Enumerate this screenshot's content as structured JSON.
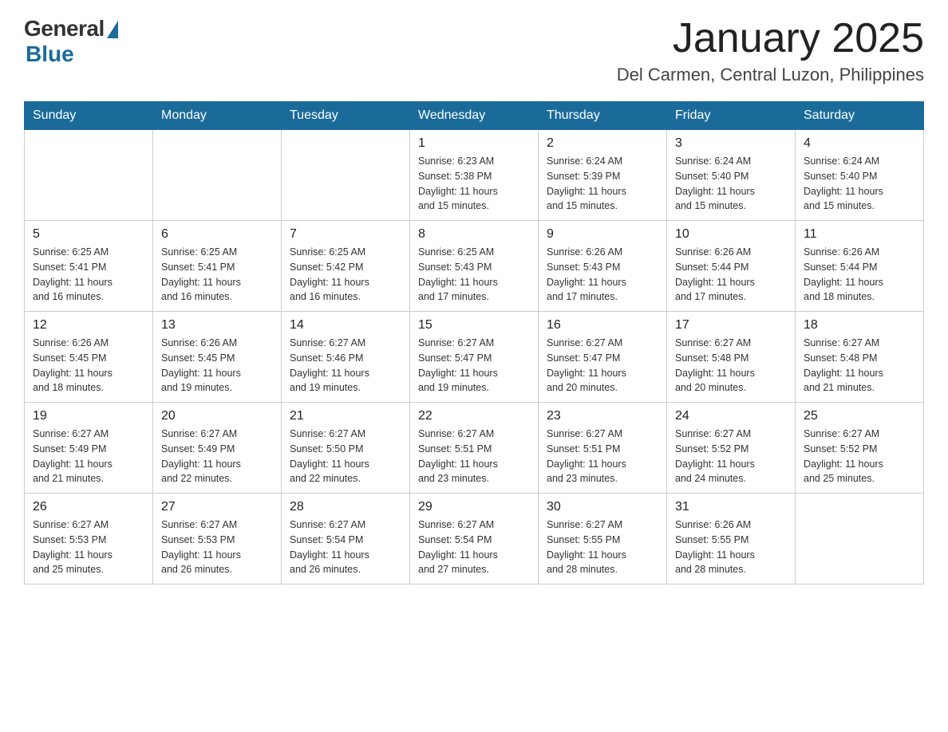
{
  "header": {
    "logo_general": "General",
    "logo_blue": "Blue",
    "month_title": "January 2025",
    "location": "Del Carmen, Central Luzon, Philippines"
  },
  "weekdays": [
    "Sunday",
    "Monday",
    "Tuesday",
    "Wednesday",
    "Thursday",
    "Friday",
    "Saturday"
  ],
  "weeks": [
    [
      {
        "day": "",
        "info": ""
      },
      {
        "day": "",
        "info": ""
      },
      {
        "day": "",
        "info": ""
      },
      {
        "day": "1",
        "info": "Sunrise: 6:23 AM\nSunset: 5:38 PM\nDaylight: 11 hours\nand 15 minutes."
      },
      {
        "day": "2",
        "info": "Sunrise: 6:24 AM\nSunset: 5:39 PM\nDaylight: 11 hours\nand 15 minutes."
      },
      {
        "day": "3",
        "info": "Sunrise: 6:24 AM\nSunset: 5:40 PM\nDaylight: 11 hours\nand 15 minutes."
      },
      {
        "day": "4",
        "info": "Sunrise: 6:24 AM\nSunset: 5:40 PM\nDaylight: 11 hours\nand 15 minutes."
      }
    ],
    [
      {
        "day": "5",
        "info": "Sunrise: 6:25 AM\nSunset: 5:41 PM\nDaylight: 11 hours\nand 16 minutes."
      },
      {
        "day": "6",
        "info": "Sunrise: 6:25 AM\nSunset: 5:41 PM\nDaylight: 11 hours\nand 16 minutes."
      },
      {
        "day": "7",
        "info": "Sunrise: 6:25 AM\nSunset: 5:42 PM\nDaylight: 11 hours\nand 16 minutes."
      },
      {
        "day": "8",
        "info": "Sunrise: 6:25 AM\nSunset: 5:43 PM\nDaylight: 11 hours\nand 17 minutes."
      },
      {
        "day": "9",
        "info": "Sunrise: 6:26 AM\nSunset: 5:43 PM\nDaylight: 11 hours\nand 17 minutes."
      },
      {
        "day": "10",
        "info": "Sunrise: 6:26 AM\nSunset: 5:44 PM\nDaylight: 11 hours\nand 17 minutes."
      },
      {
        "day": "11",
        "info": "Sunrise: 6:26 AM\nSunset: 5:44 PM\nDaylight: 11 hours\nand 18 minutes."
      }
    ],
    [
      {
        "day": "12",
        "info": "Sunrise: 6:26 AM\nSunset: 5:45 PM\nDaylight: 11 hours\nand 18 minutes."
      },
      {
        "day": "13",
        "info": "Sunrise: 6:26 AM\nSunset: 5:45 PM\nDaylight: 11 hours\nand 19 minutes."
      },
      {
        "day": "14",
        "info": "Sunrise: 6:27 AM\nSunset: 5:46 PM\nDaylight: 11 hours\nand 19 minutes."
      },
      {
        "day": "15",
        "info": "Sunrise: 6:27 AM\nSunset: 5:47 PM\nDaylight: 11 hours\nand 19 minutes."
      },
      {
        "day": "16",
        "info": "Sunrise: 6:27 AM\nSunset: 5:47 PM\nDaylight: 11 hours\nand 20 minutes."
      },
      {
        "day": "17",
        "info": "Sunrise: 6:27 AM\nSunset: 5:48 PM\nDaylight: 11 hours\nand 20 minutes."
      },
      {
        "day": "18",
        "info": "Sunrise: 6:27 AM\nSunset: 5:48 PM\nDaylight: 11 hours\nand 21 minutes."
      }
    ],
    [
      {
        "day": "19",
        "info": "Sunrise: 6:27 AM\nSunset: 5:49 PM\nDaylight: 11 hours\nand 21 minutes."
      },
      {
        "day": "20",
        "info": "Sunrise: 6:27 AM\nSunset: 5:49 PM\nDaylight: 11 hours\nand 22 minutes."
      },
      {
        "day": "21",
        "info": "Sunrise: 6:27 AM\nSunset: 5:50 PM\nDaylight: 11 hours\nand 22 minutes."
      },
      {
        "day": "22",
        "info": "Sunrise: 6:27 AM\nSunset: 5:51 PM\nDaylight: 11 hours\nand 23 minutes."
      },
      {
        "day": "23",
        "info": "Sunrise: 6:27 AM\nSunset: 5:51 PM\nDaylight: 11 hours\nand 23 minutes."
      },
      {
        "day": "24",
        "info": "Sunrise: 6:27 AM\nSunset: 5:52 PM\nDaylight: 11 hours\nand 24 minutes."
      },
      {
        "day": "25",
        "info": "Sunrise: 6:27 AM\nSunset: 5:52 PM\nDaylight: 11 hours\nand 25 minutes."
      }
    ],
    [
      {
        "day": "26",
        "info": "Sunrise: 6:27 AM\nSunset: 5:53 PM\nDaylight: 11 hours\nand 25 minutes."
      },
      {
        "day": "27",
        "info": "Sunrise: 6:27 AM\nSunset: 5:53 PM\nDaylight: 11 hours\nand 26 minutes."
      },
      {
        "day": "28",
        "info": "Sunrise: 6:27 AM\nSunset: 5:54 PM\nDaylight: 11 hours\nand 26 minutes."
      },
      {
        "day": "29",
        "info": "Sunrise: 6:27 AM\nSunset: 5:54 PM\nDaylight: 11 hours\nand 27 minutes."
      },
      {
        "day": "30",
        "info": "Sunrise: 6:27 AM\nSunset: 5:55 PM\nDaylight: 11 hours\nand 28 minutes."
      },
      {
        "day": "31",
        "info": "Sunrise: 6:26 AM\nSunset: 5:55 PM\nDaylight: 11 hours\nand 28 minutes."
      },
      {
        "day": "",
        "info": ""
      }
    ]
  ]
}
